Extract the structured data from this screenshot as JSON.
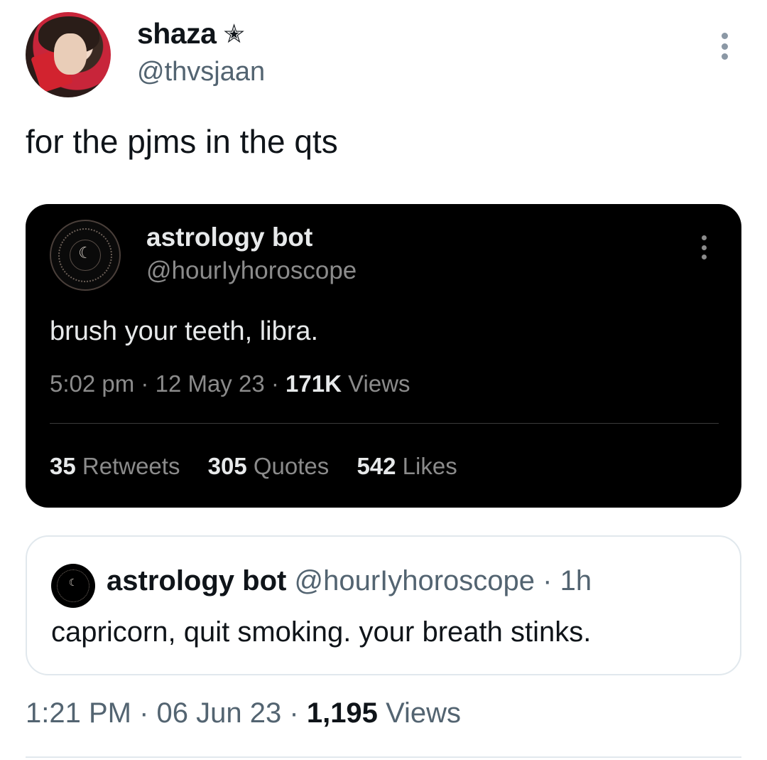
{
  "author": {
    "display_name": "shaza",
    "badge_icon": "star-icon",
    "badge_glyph": "✭",
    "handle": "@thvsjaan"
  },
  "tweet": {
    "text": "for the pjms in the qts",
    "time": "1:21 PM",
    "date": "06 Jun 23",
    "views_count": "1,195",
    "views_label": "Views"
  },
  "media_screenshot": {
    "name": "astrology bot",
    "handle": "@hourIyhoroscope",
    "avatar_glyph": "☾",
    "text": "brush your teeth, libra.",
    "time": "5:02 pm",
    "date": "12 May 23",
    "views_count": "171K",
    "views_label": "Views",
    "stats": [
      {
        "count": "35",
        "label": "Retweets"
      },
      {
        "count": "305",
        "label": "Quotes"
      },
      {
        "count": "542",
        "label": "Likes"
      }
    ]
  },
  "quoted_tweet": {
    "name": "astrology bot",
    "handle": "@hourIyhoroscope",
    "time_ago": "1h",
    "avatar_glyph": "☾",
    "text": "capricorn, quit smoking. your breath stinks."
  },
  "separator": "·"
}
